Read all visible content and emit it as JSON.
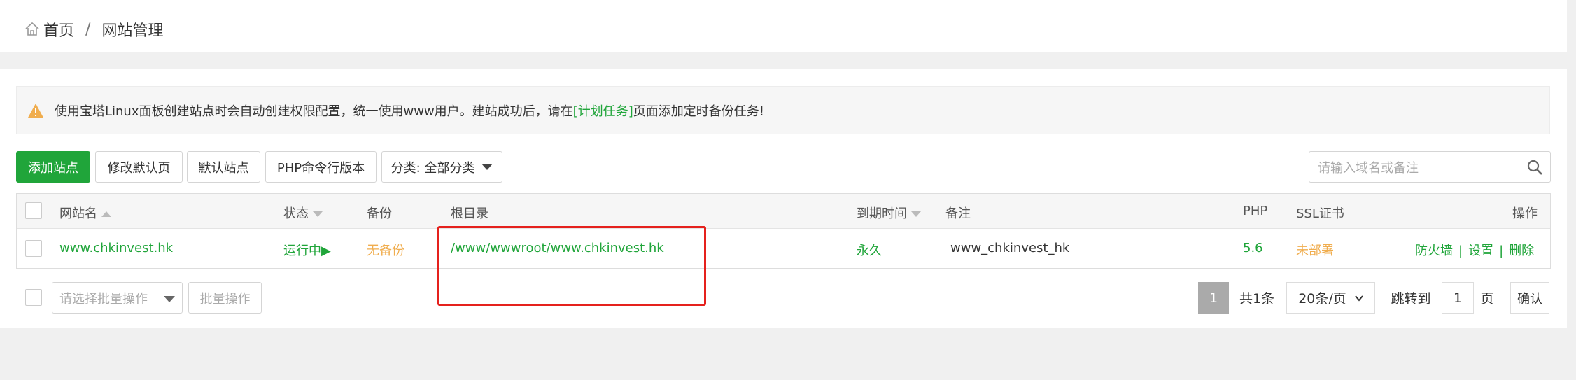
{
  "breadcrumb": {
    "home": "首页",
    "separator": "/",
    "current": "网站管理"
  },
  "notice": {
    "text_before": "使用宝塔Linux面板创建站点时会自动创建权限配置，统一使用www用户。建站成功后，请在",
    "link": "[计划任务]",
    "text_after": "页面添加定时备份任务!"
  },
  "toolbar": {
    "add_site": "添加站点",
    "edit_default_page": "修改默认页",
    "default_site": "默认站点",
    "php_cli_version": "PHP命令行版本",
    "category": "分类: 全部分类"
  },
  "search": {
    "placeholder": "请输入域名或备注"
  },
  "table": {
    "headers": {
      "site_name": "网站名",
      "status": "状态",
      "backup": "备份",
      "root_dir": "根目录",
      "expire": "到期时间",
      "remark": "备注",
      "php": "PHP",
      "ssl": "SSL证书",
      "actions": "操作"
    },
    "rows": [
      {
        "site_name": "www.chkinvest.hk",
        "status": "运行中▶",
        "backup": "无备份",
        "root_dir": "/www/wwwroot/www.chkinvest.hk",
        "expire": "永久",
        "remark": "www_chkinvest_hk",
        "php": "5.6",
        "ssl": "未部署",
        "action_firewall": "防火墙",
        "action_settings": "设置",
        "action_delete": "删除",
        "action_sep": "|"
      }
    ]
  },
  "bottom": {
    "batch_select_placeholder": "请选择批量操作",
    "batch_button": "批量操作"
  },
  "pagination": {
    "current_page": "1",
    "total": "共1条",
    "per_page": "20条/页",
    "jump_label": "跳转到",
    "jump_value": "1",
    "page_unit": "页",
    "confirm": "确认"
  },
  "colors": {
    "accent": "#20a53a",
    "warning": "#f0ad4e",
    "highlight": "#e5211d"
  }
}
